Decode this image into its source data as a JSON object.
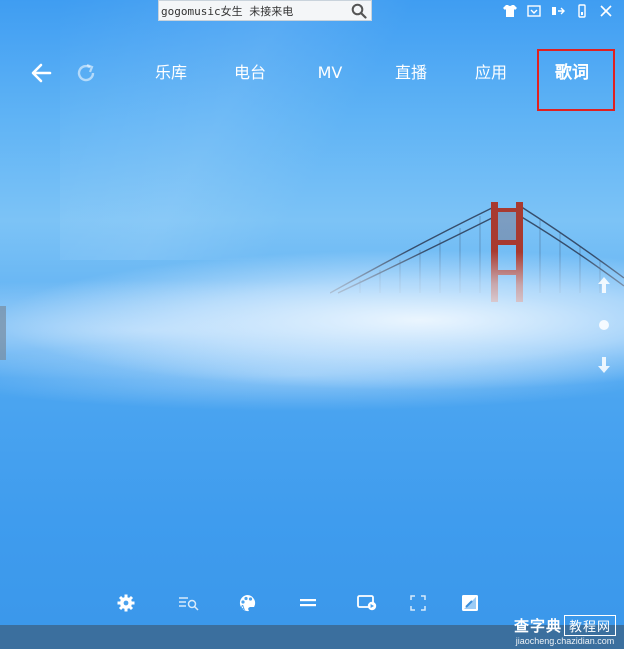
{
  "search": {
    "value": "gogomusic女生 未接来电",
    "icon": "search-icon"
  },
  "window_controls": [
    "skin-icon",
    "mini-mode-icon",
    "minimize-icon",
    "menu-icon",
    "close-icon"
  ],
  "nav": {
    "back_icon": "back-arrow-icon",
    "refresh_icon": "refresh-icon",
    "tabs": [
      {
        "label": "乐库"
      },
      {
        "label": "电台"
      },
      {
        "label": "MV"
      },
      {
        "label": "直播"
      },
      {
        "label": "应用"
      },
      {
        "label": "歌词",
        "active": true
      }
    ]
  },
  "highlight_color": "#e02020",
  "toolbar": [
    "settings-icon",
    "search-lyrics-icon",
    "lyric-color-icon",
    "adjust-icon",
    "desktop-lyrics-icon",
    "fullscreen-icon",
    "theme-icon"
  ],
  "watermark": {
    "brand": "查字典",
    "tag": "教程网",
    "url": "jiaocheng.chazidian.com"
  }
}
